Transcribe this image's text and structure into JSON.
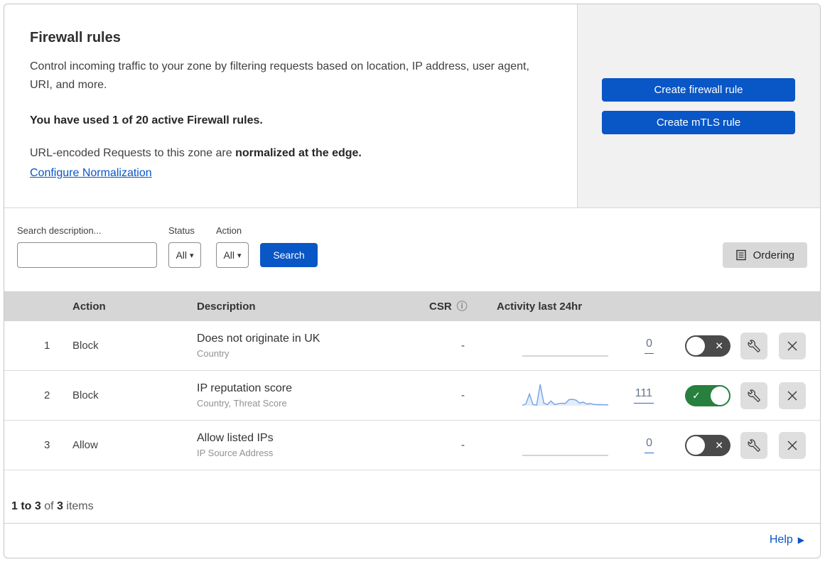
{
  "colors": {
    "accent_blue": "#0956c6",
    "toggle_on_green": "#27803d",
    "toggle_off_gray": "#4a4a4a",
    "table_header_bg": "#d6d6d6",
    "side_panel_gray": "#f1f1f1",
    "sparkline_blue": "#74a1e8"
  },
  "header": {
    "title": "Firewall rules",
    "description": "Control incoming traffic to your zone by filtering requests based on location, IP address, user agent, URI, and more.",
    "usage_line": "You have used 1 of 20 active Firewall rules.",
    "normalization_text": "URL-encoded Requests to this zone are ",
    "normalization_bold": "normalized at the edge.",
    "configure_link": "Configure Normalization",
    "create_firewall_button": "Create firewall rule",
    "create_mtls_button": "Create mTLS rule"
  },
  "filters": {
    "search_label": "Search description...",
    "search_value": "",
    "status_label": "Status",
    "status_value": "All",
    "action_label": "Action",
    "action_value": "All",
    "search_button": "Search",
    "ordering_button": "Ordering"
  },
  "table": {
    "headers": {
      "action": "Action",
      "description": "Description",
      "csr": "CSR",
      "activity": "Activity last 24hr"
    },
    "rows": [
      {
        "index": "1",
        "action": "Block",
        "description": "Does not originate in UK",
        "fields": "Country",
        "csr": "-",
        "activity_count": "0",
        "enabled": false,
        "sparkline": null
      },
      {
        "index": "2",
        "action": "Block",
        "description": "IP reputation score",
        "fields": "Country, Threat Score",
        "csr": "-",
        "activity_count": "111",
        "enabled": true,
        "sparkline": [
          2,
          8,
          55,
          5,
          3,
          100,
          12,
          5,
          22,
          6,
          9,
          12,
          10,
          28,
          30,
          26,
          12,
          17,
          8,
          10,
          6,
          5,
          5,
          4,
          4
        ]
      },
      {
        "index": "3",
        "action": "Allow",
        "description": "Allow listed IPs",
        "fields": "IP Source Address",
        "csr": "-",
        "activity_count": "0",
        "enabled": false,
        "sparkline": null
      }
    ]
  },
  "footer": {
    "range": "1 to 3",
    "of": "of",
    "total": "3",
    "items": "items"
  },
  "help": {
    "label": "Help",
    "arrow": "▶"
  },
  "icons": {
    "info": "ⓘ",
    "caret": "▾",
    "check": "✓",
    "cross": "✕"
  }
}
